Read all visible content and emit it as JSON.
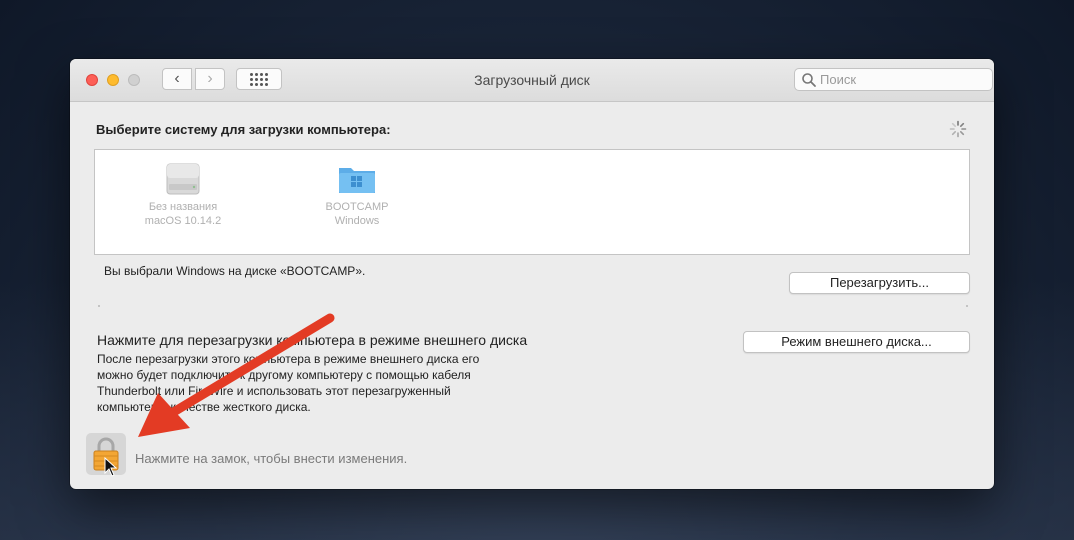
{
  "window": {
    "title": "Загрузочный диск",
    "search_placeholder": "Поиск"
  },
  "main": {
    "heading": "Выберите систему для загрузки компьютера:",
    "disks": [
      {
        "name": "Без названия",
        "system": "macOS 10.14.2",
        "icon": "hard-drive-icon"
      },
      {
        "name": "BOOTCAMP",
        "system": "Windows",
        "icon": "folder-icon"
      }
    ],
    "selected_text": "Вы выбрали Windows на диске «BOOTCAMP».",
    "restart_label": "Перезагрузить...",
    "target_title": "Нажмите для перезагрузки компьютера в режиме внешнего диска",
    "target_button_label": "Режим внешнего диска...",
    "target_desc_lines": [
      "После перезагрузки этого компьютера в режиме внешнего диска его",
      "можно будет подключить к другому компьютеру с помощью кабеля",
      "Thunderbolt или FireWire и использовать этот перезагруженный",
      "компьютер в качестве жесткого диска."
    ]
  },
  "footer": {
    "lock_text": "Нажмите на замок, чтобы внести изменения."
  },
  "colors": {
    "annotation_arrow": "#e33b24",
    "close": "#fd5f57",
    "minimize": "#febb2e"
  }
}
